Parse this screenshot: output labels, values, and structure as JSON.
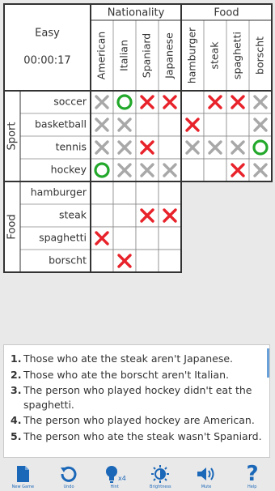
{
  "puzzle": {
    "difficulty": "Easy",
    "timer": "00:00:17",
    "top_groups": [
      "Nationality",
      "Food"
    ],
    "top_items": [
      "American",
      "Italian",
      "Spaniard",
      "Japanese",
      "hamburger",
      "steak",
      "spaghetti",
      "borscht"
    ],
    "left_groups": [
      "Sport",
      "Food"
    ],
    "left_items": [
      "soccer",
      "basketball",
      "tennis",
      "hockey",
      "hamburger",
      "steak",
      "spaghetti",
      "borscht"
    ],
    "marks": [
      [
        "X",
        "O",
        "R",
        "R",
        "",
        "R",
        "R",
        "X"
      ],
      [
        "X",
        "X",
        "",
        "",
        "R",
        "",
        "",
        "X"
      ],
      [
        "X",
        "X",
        "R",
        "",
        "X",
        "X",
        "X",
        "O"
      ],
      [
        "O",
        "X",
        "X",
        "X",
        "",
        "",
        "R",
        "X"
      ],
      [
        "",
        "",
        "",
        "",
        null,
        null,
        null,
        null
      ],
      [
        "",
        "",
        "R",
        "R",
        null,
        null,
        null,
        null
      ],
      [
        "R",
        "",
        "",
        "",
        null,
        null,
        null,
        null
      ],
      [
        "",
        "R",
        "",
        "",
        null,
        null,
        null,
        null
      ]
    ],
    "mark_legend": {
      "X": "gray cross",
      "R": "red cross",
      "O": "green circle"
    },
    "colors": {
      "gray_x": "#a8a8a8",
      "red_x": "#e8222a",
      "green_o": "#22a82a",
      "grid_line": "#333333"
    }
  },
  "clues": [
    {
      "num": "1.",
      "text": "Those who ate the steak aren't Japanese."
    },
    {
      "num": "2.",
      "text": "Those who ate the borscht aren't Italian."
    },
    {
      "num": "3.",
      "text": "The person who played hockey didn't eat the spaghetti."
    },
    {
      "num": "4.",
      "text": "The person who played hockey are American."
    },
    {
      "num": "5.",
      "text": "The person who ate the steak wasn't Spaniard."
    }
  ],
  "toolbar": [
    {
      "label": "New Game",
      "icon": "new-game-icon"
    },
    {
      "label": "Undo",
      "icon": "undo-icon"
    },
    {
      "label": "Hint",
      "icon": "hint-bulb-icon",
      "badge": "x4"
    },
    {
      "label": "Brightness",
      "icon": "brightness-icon"
    },
    {
      "label": "Mute",
      "icon": "speaker-icon"
    },
    {
      "label": "Help",
      "icon": "help-icon"
    }
  ]
}
